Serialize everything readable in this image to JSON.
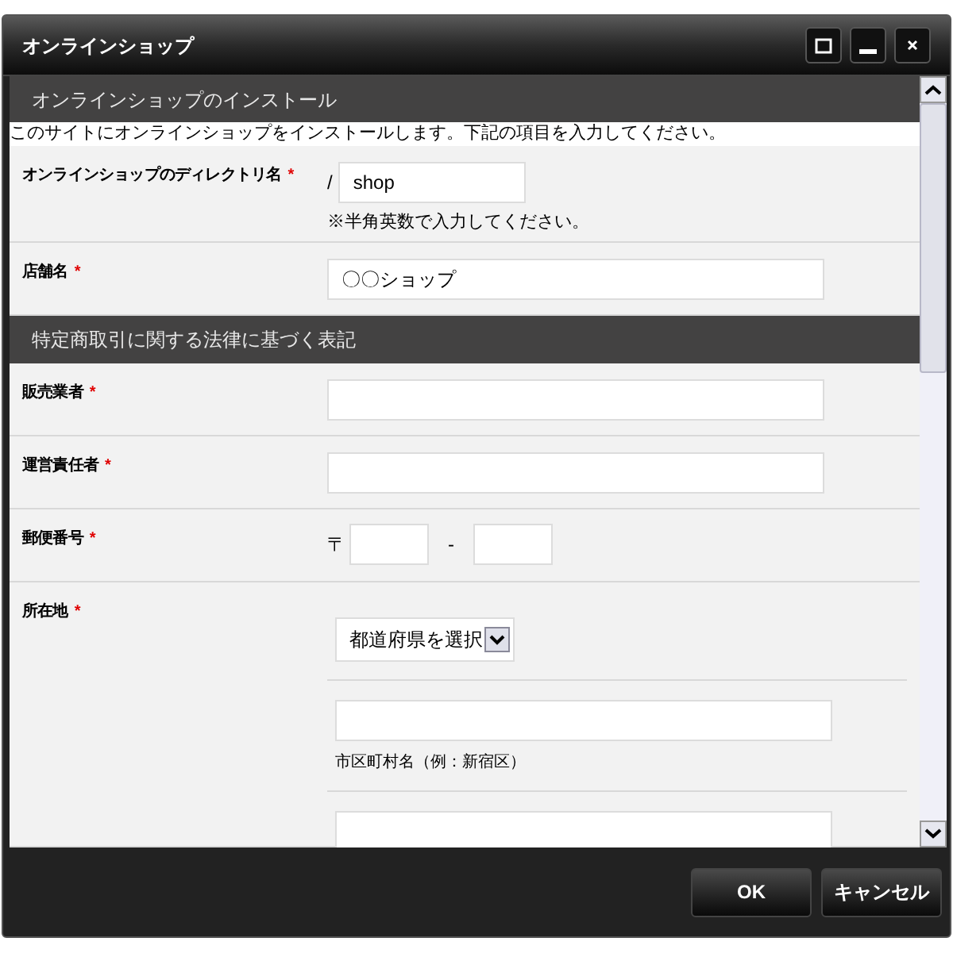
{
  "window": {
    "title": "オンラインショップ"
  },
  "content": [
    {
      "kind": "header",
      "text": "オンラインショップのインストール"
    },
    {
      "kind": "note",
      "text": "このサイトにオンラインショップをインストールします。下記の項目を入力してください。"
    },
    {
      "kind": "short_text",
      "label": "オンラインショップのディレクトリ名",
      "mark": "*",
      "prefix": "/",
      "value": "shop",
      "hint": "※半角英数で入力してください。"
    },
    {
      "kind": "text",
      "label": "店舗名",
      "mark": "*",
      "value": "〇〇ショップ"
    },
    {
      "kind": "header",
      "text": "特定商取引に関する法律に基づく表記"
    },
    {
      "kind": "text",
      "label": "販売業者",
      "mark": "*"
    },
    {
      "kind": "text",
      "label": "運営責任者",
      "mark": "*"
    },
    {
      "kind": "postal",
      "label": "郵便番号",
      "mark": "*",
      "prefix": "〒",
      "separator": "-"
    },
    {
      "kind": "address",
      "label": "所在地",
      "mark": "*",
      "select": "都道府県を選択",
      "lines": [
        {
          "kind": "input",
          "hint": "市区町村名（例：新宿区）"
        },
        {
          "kind": "input"
        }
      ]
    }
  ],
  "buttons": [
    {
      "label": "OK"
    },
    {
      "label": "キャンセル"
    }
  ]
}
